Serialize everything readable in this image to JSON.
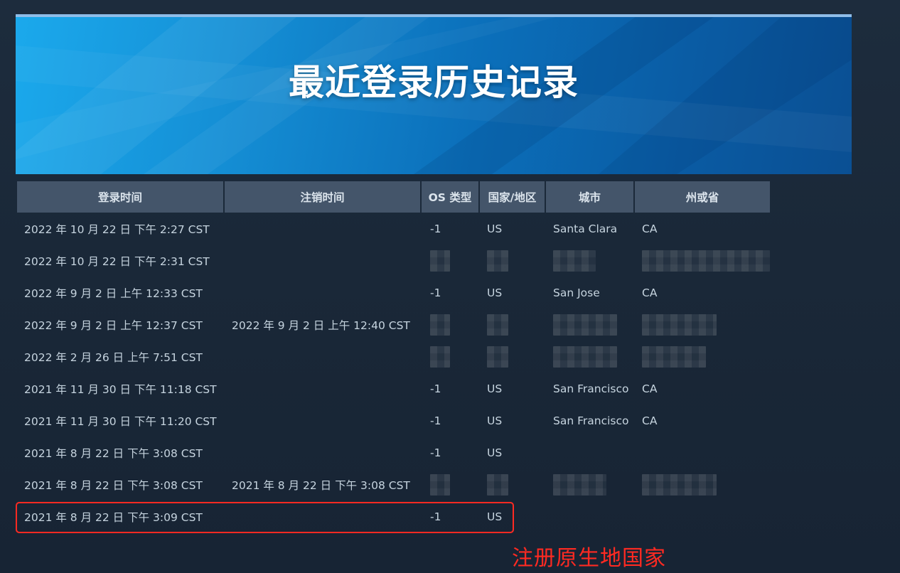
{
  "banner": {
    "title": "最近登录历史记录"
  },
  "table": {
    "headers": [
      "登录时间",
      "注销时间",
      "OS 类型",
      "国家/地区",
      "城市",
      "州或省"
    ],
    "rows": [
      {
        "login": "2022 年 10 月 22 日 下午 2:27 CST",
        "logout": "",
        "os": "-1",
        "country": "US",
        "city": "Santa Clara",
        "state": "CA"
      },
      {
        "login": "2022 年 10 月 22 日 下午 2:31 CST",
        "logout": "",
        "os": "",
        "country": "",
        "city": "",
        "state": ""
      },
      {
        "login": "2022 年 9 月 2 日 上午 12:33 CST",
        "logout": "",
        "os": "-1",
        "country": "US",
        "city": "San Jose",
        "state": "CA"
      },
      {
        "login": "2022 年 9 月 2 日 上午 12:37 CST",
        "logout": "2022 年 9 月 2 日 上午 12:40 CST",
        "os": "",
        "country": "",
        "city": "",
        "state": ""
      },
      {
        "login": "2022 年 2 月 26 日 上午 7:51 CST",
        "logout": "",
        "os": "",
        "country": "",
        "city": "",
        "state": ""
      },
      {
        "login": "2021 年 11 月 30 日 下午 11:18 CST",
        "logout": "",
        "os": "-1",
        "country": "US",
        "city": "San Francisco",
        "state": "CA"
      },
      {
        "login": "2021 年 11 月 30 日 下午 11:20 CST",
        "logout": "",
        "os": "-1",
        "country": "US",
        "city": "San Francisco",
        "state": "CA"
      },
      {
        "login": "2021 年 8 月 22 日 下午 3:08 CST",
        "logout": "",
        "os": "-1",
        "country": "US",
        "city": "",
        "state": ""
      },
      {
        "login": "2021 年 8 月 22 日 下午 3:08 CST",
        "logout": "2021 年 8 月 22 日 下午 3:08 CST",
        "os": "",
        "country": "",
        "city": "",
        "state": ""
      },
      {
        "login": "2021 年 8 月 22 日 下午 3:09 CST",
        "logout": "",
        "os": "-1",
        "country": "US",
        "city": "",
        "state": ""
      }
    ]
  },
  "annotation": {
    "text": "注册原生地国家",
    "color": "#ff2a22"
  },
  "colors": {
    "header_bg": "#44556a",
    "page_bg": "#1b2838",
    "banner_blue": "#1590d6"
  }
}
